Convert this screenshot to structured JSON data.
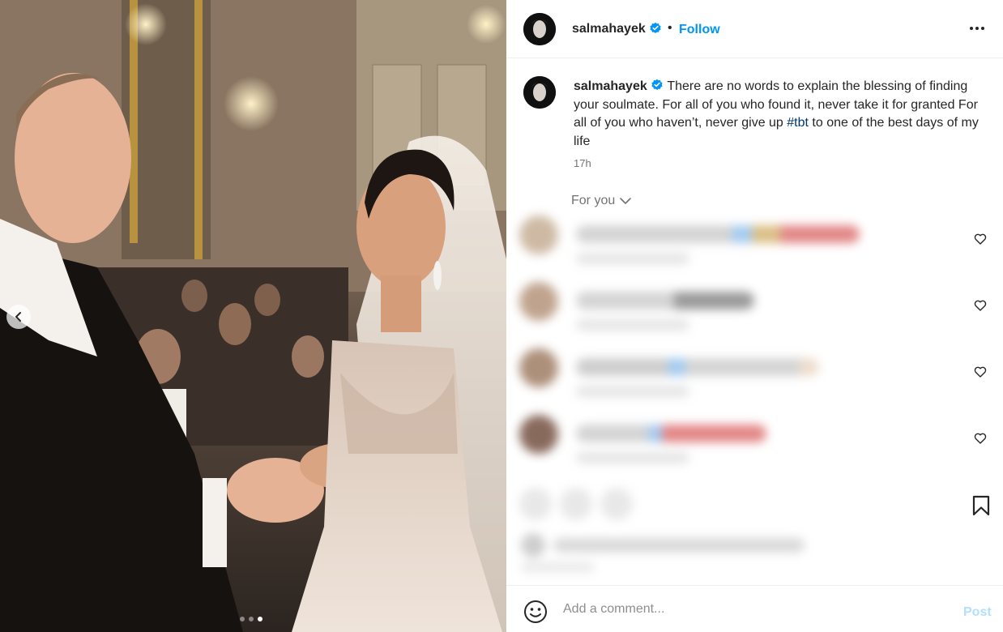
{
  "post": {
    "username": "salmahayek",
    "verified": true,
    "follow_label": "Follow",
    "separator": "•",
    "caption_text": "There are no words to explain the blessing of finding your soulmate. For all of you who found it, never take it for granted For all of you who haven’t, never give up ",
    "hashtag": "#tbt",
    "caption_tail": " to one of the best days of my life",
    "time": "17h"
  },
  "comments_section": {
    "filter_label": "For you",
    "blurred": true,
    "row_count": 4
  },
  "composer": {
    "placeholder": "Add a comment...",
    "post_label": "Post"
  },
  "carousel": {
    "slide_count": 3,
    "active_slide": 3
  },
  "colors": {
    "link_blue": "#0095f6",
    "hashtag": "#00376b",
    "verified_badge": "#0095f6",
    "muted_text": "#737373",
    "post_disabled": "#b2dffc"
  },
  "icons": {
    "carousel_prev": "chevron-left-icon",
    "more": "more-options-icon",
    "verified": "verified-badge-icon",
    "like": "heart-icon",
    "save": "bookmark-icon",
    "emoji": "emoji-icon"
  }
}
